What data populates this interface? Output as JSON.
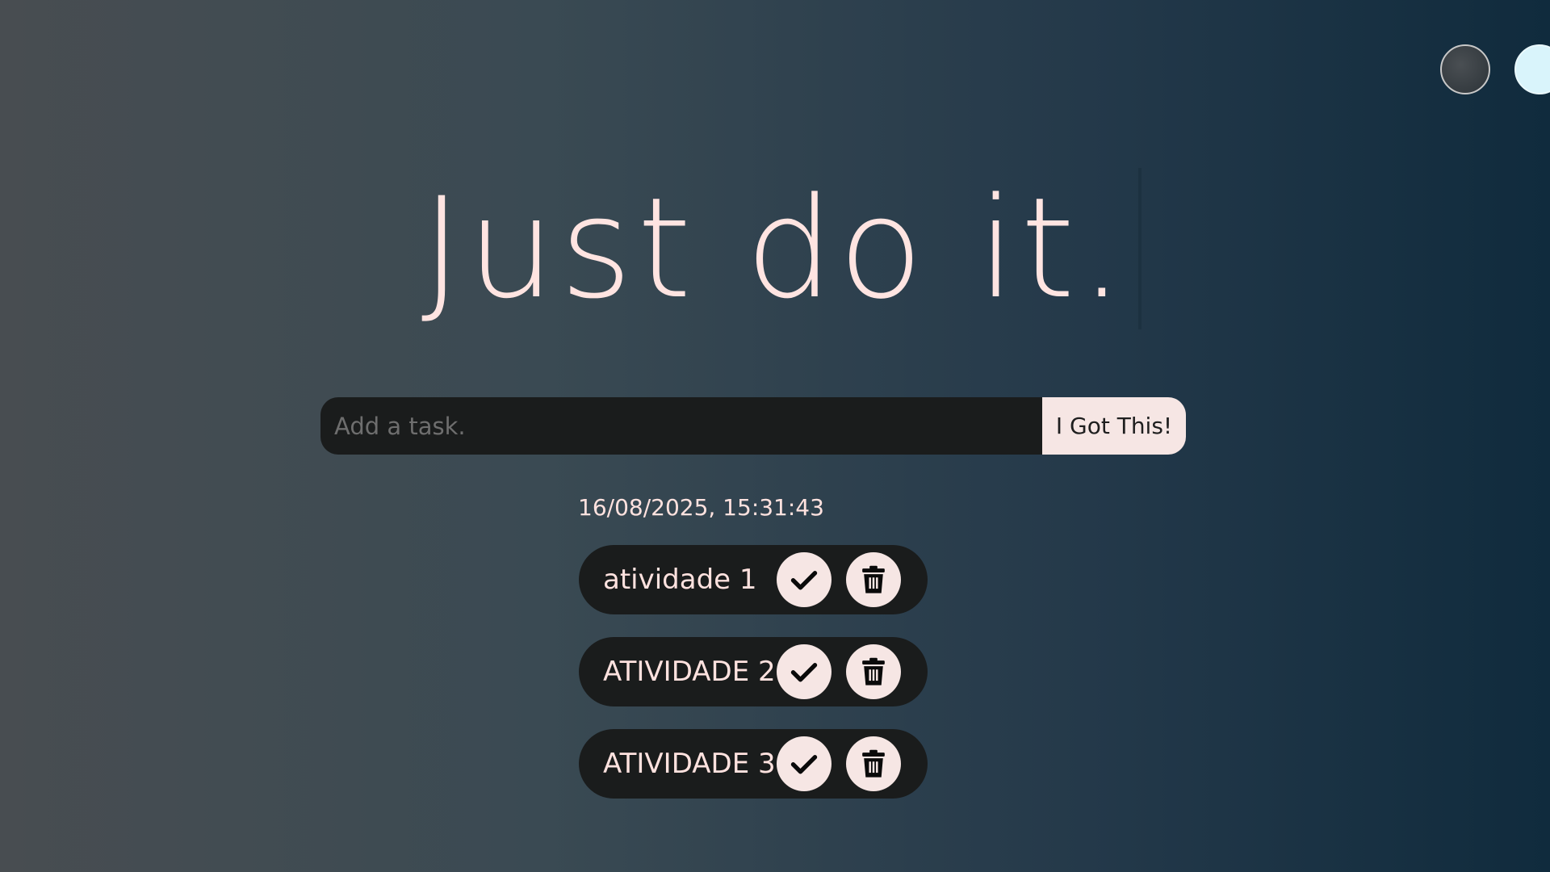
{
  "theme_switcher": {
    "options": [
      {
        "name": "standard"
      },
      {
        "name": "light"
      }
    ]
  },
  "header": {
    "title": "Just do it."
  },
  "task_form": {
    "placeholder": "Add a task.",
    "value": "",
    "button_label": "I Got This!"
  },
  "datetime": "16/08/2025, 15:31:43",
  "todos": [
    {
      "text": "atividade 1",
      "check_icon": "check-icon",
      "delete_icon": "trash-icon"
    },
    {
      "text": "ATIVIDADE 2",
      "check_icon": "check-icon",
      "delete_icon": "trash-icon"
    },
    {
      "text": "ATIVIDADE 3",
      "check_icon": "check-icon",
      "delete_icon": "trash-icon"
    }
  ],
  "colors": {
    "accent": "#ffe4e1",
    "button_bg": "#f6e6e4",
    "dark_surface": "#1a1c1c",
    "gradient_start": "#484d51",
    "gradient_end": "#102b3d"
  }
}
